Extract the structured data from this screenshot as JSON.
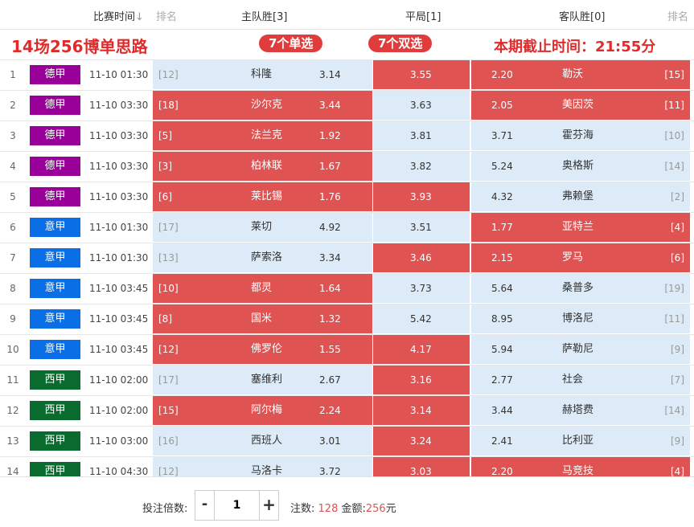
{
  "header": {
    "time_col": "比赛时间",
    "rank_left": "排名",
    "home_col": "主队胜[3]",
    "draw_col": "平局[1]",
    "away_col": "客队胜[0]",
    "rank_right": "排名"
  },
  "banner": {
    "title": "14场256博单思路",
    "single_pill": "7个单选",
    "double_pill": "7个双选",
    "deadline": "本期截止时间：21:55分"
  },
  "colors": {
    "selected": "#e05353",
    "unselected": "#dcebf7",
    "bundesliga": "#990099",
    "serie_a": "#0a6ee6",
    "la_liga": "#0a6b2f"
  },
  "matches": [
    {
      "no": "1",
      "league": "德甲",
      "time": "11-10 01:30",
      "home_rank": "[12]",
      "home": "科隆",
      "home_odds": "3.14",
      "draw_odds": "3.55",
      "away_odds": "2.20",
      "away": "勒沃",
      "away_rank": "[15]",
      "sel_home": false,
      "sel_draw": true,
      "sel_away": true
    },
    {
      "no": "2",
      "league": "德甲",
      "time": "11-10 03:30",
      "home_rank": "[18]",
      "home": "沙尔克",
      "home_odds": "3.44",
      "draw_odds": "3.63",
      "away_odds": "2.05",
      "away": "美因茨",
      "away_rank": "[11]",
      "sel_home": true,
      "sel_draw": false,
      "sel_away": true
    },
    {
      "no": "3",
      "league": "德甲",
      "time": "11-10 03:30",
      "home_rank": "[5]",
      "home": "法兰克",
      "home_odds": "1.92",
      "draw_odds": "3.81",
      "away_odds": "3.71",
      "away": "霍芬海",
      "away_rank": "[10]",
      "sel_home": true,
      "sel_draw": false,
      "sel_away": false
    },
    {
      "no": "4",
      "league": "德甲",
      "time": "11-10 03:30",
      "home_rank": "[3]",
      "home": "柏林联",
      "home_odds": "1.67",
      "draw_odds": "3.82",
      "away_odds": "5.24",
      "away": "奥格斯",
      "away_rank": "[14]",
      "sel_home": true,
      "sel_draw": false,
      "sel_away": false
    },
    {
      "no": "5",
      "league": "德甲",
      "time": "11-10 03:30",
      "home_rank": "[6]",
      "home": "莱比锡",
      "home_odds": "1.76",
      "draw_odds": "3.93",
      "away_odds": "4.32",
      "away": "弗赖堡",
      "away_rank": "[2]",
      "sel_home": true,
      "sel_draw": true,
      "sel_away": false
    },
    {
      "no": "6",
      "league": "意甲",
      "time": "11-10 01:30",
      "home_rank": "[17]",
      "home": "莱切",
      "home_odds": "4.92",
      "draw_odds": "3.51",
      "away_odds": "1.77",
      "away": "亚特兰",
      "away_rank": "[4]",
      "sel_home": false,
      "sel_draw": false,
      "sel_away": true
    },
    {
      "no": "7",
      "league": "意甲",
      "time": "11-10 01:30",
      "home_rank": "[13]",
      "home": "萨索洛",
      "home_odds": "3.34",
      "draw_odds": "3.46",
      "away_odds": "2.15",
      "away": "罗马",
      "away_rank": "[6]",
      "sel_home": false,
      "sel_draw": true,
      "sel_away": true
    },
    {
      "no": "8",
      "league": "意甲",
      "time": "11-10 03:45",
      "home_rank": "[10]",
      "home": "都灵",
      "home_odds": "1.64",
      "draw_odds": "3.73",
      "away_odds": "5.64",
      "away": "桑普多",
      "away_rank": "[19]",
      "sel_home": true,
      "sel_draw": false,
      "sel_away": false
    },
    {
      "no": "9",
      "league": "意甲",
      "time": "11-10 03:45",
      "home_rank": "[8]",
      "home": "国米",
      "home_odds": "1.32",
      "draw_odds": "5.42",
      "away_odds": "8.95",
      "away": "博洛尼",
      "away_rank": "[11]",
      "sel_home": true,
      "sel_draw": false,
      "sel_away": false
    },
    {
      "no": "10",
      "league": "意甲",
      "time": "11-10 03:45",
      "home_rank": "[12]",
      "home": "佛罗伦",
      "home_odds": "1.55",
      "draw_odds": "4.17",
      "away_odds": "5.94",
      "away": "萨勒尼",
      "away_rank": "[9]",
      "sel_home": true,
      "sel_draw": true,
      "sel_away": false
    },
    {
      "no": "11",
      "league": "西甲",
      "time": "11-10 02:00",
      "home_rank": "[17]",
      "home": "塞维利",
      "home_odds": "2.67",
      "draw_odds": "3.16",
      "away_odds": "2.77",
      "away": "社会",
      "away_rank": "[7]",
      "sel_home": false,
      "sel_draw": true,
      "sel_away": false
    },
    {
      "no": "12",
      "league": "西甲",
      "time": "11-10 02:00",
      "home_rank": "[15]",
      "home": "阿尔梅",
      "home_odds": "2.24",
      "draw_odds": "3.14",
      "away_odds": "3.44",
      "away": "赫塔费",
      "away_rank": "[14]",
      "sel_home": true,
      "sel_draw": true,
      "sel_away": false
    },
    {
      "no": "13",
      "league": "西甲",
      "time": "11-10 03:00",
      "home_rank": "[16]",
      "home": "西班人",
      "home_odds": "3.01",
      "draw_odds": "3.24",
      "away_odds": "2.41",
      "away": "比利亚",
      "away_rank": "[9]",
      "sel_home": false,
      "sel_draw": true,
      "sel_away": false
    },
    {
      "no": "14",
      "league": "西甲",
      "time": "11-10 04:30",
      "home_rank": "[12]",
      "home": "马洛卡",
      "home_odds": "3.72",
      "draw_odds": "3.03",
      "away_odds": "2.20",
      "away": "马竞技",
      "away_rank": "[4]",
      "sel_home": false,
      "sel_draw": true,
      "sel_away": true
    }
  ],
  "footer": {
    "multiplier_label": "投注倍数:",
    "minus": "-",
    "plus": "+",
    "multiplier_value": "1",
    "bets_label": "注数:",
    "bets_value": "128",
    "amount_label": "金额:",
    "amount_value": "256",
    "amount_unit": "元"
  }
}
